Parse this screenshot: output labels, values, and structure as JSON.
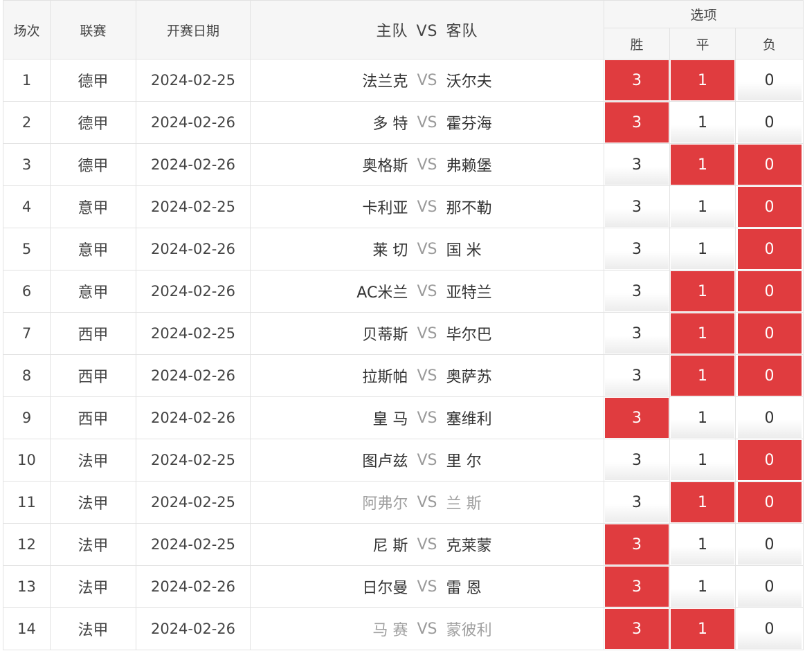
{
  "header": {
    "col_no": "场次",
    "col_league": "联赛",
    "col_date": "开赛日期",
    "col_home": "主队",
    "col_vs": "VS",
    "col_away": "客队",
    "col_options": "选项",
    "opt_win": "胜",
    "opt_draw": "平",
    "opt_loss": "负"
  },
  "colors": {
    "selected": "#e03c3f",
    "muted_team": "#a0a0a0"
  },
  "rows": [
    {
      "no": "1",
      "league": "德甲",
      "date": "2024-02-25",
      "home": "法兰克",
      "vs": "VS",
      "away": "沃尔夫",
      "muted_home": false,
      "muted_away": false,
      "win": "3",
      "draw": "1",
      "loss": "0",
      "sel": [
        true,
        true,
        false
      ]
    },
    {
      "no": "2",
      "league": "德甲",
      "date": "2024-02-26",
      "home": "多 特",
      "vs": "VS",
      "away": "霍芬海",
      "muted_home": false,
      "muted_away": false,
      "win": "3",
      "draw": "1",
      "loss": "0",
      "sel": [
        true,
        false,
        false
      ]
    },
    {
      "no": "3",
      "league": "德甲",
      "date": "2024-02-26",
      "home": "奥格斯",
      "vs": "VS",
      "away": "弗赖堡",
      "muted_home": false,
      "muted_away": false,
      "win": "3",
      "draw": "1",
      "loss": "0",
      "sel": [
        false,
        true,
        true
      ]
    },
    {
      "no": "4",
      "league": "意甲",
      "date": "2024-02-25",
      "home": "卡利亚",
      "vs": "VS",
      "away": "那不勒",
      "muted_home": false,
      "muted_away": false,
      "win": "3",
      "draw": "1",
      "loss": "0",
      "sel": [
        false,
        false,
        true
      ]
    },
    {
      "no": "5",
      "league": "意甲",
      "date": "2024-02-26",
      "home": "莱 切",
      "vs": "VS",
      "away": "国 米",
      "muted_home": false,
      "muted_away": false,
      "win": "3",
      "draw": "1",
      "loss": "0",
      "sel": [
        false,
        false,
        true
      ]
    },
    {
      "no": "6",
      "league": "意甲",
      "date": "2024-02-26",
      "home": "AC米兰",
      "vs": "VS",
      "away": "亚特兰",
      "muted_home": false,
      "muted_away": false,
      "win": "3",
      "draw": "1",
      "loss": "0",
      "sel": [
        false,
        true,
        true
      ]
    },
    {
      "no": "7",
      "league": "西甲",
      "date": "2024-02-25",
      "home": "贝蒂斯",
      "vs": "VS",
      "away": "毕尔巴",
      "muted_home": false,
      "muted_away": false,
      "win": "3",
      "draw": "1",
      "loss": "0",
      "sel": [
        false,
        true,
        true
      ]
    },
    {
      "no": "8",
      "league": "西甲",
      "date": "2024-02-26",
      "home": "拉斯帕",
      "vs": "VS",
      "away": "奥萨苏",
      "muted_home": false,
      "muted_away": false,
      "win": "3",
      "draw": "1",
      "loss": "0",
      "sel": [
        false,
        true,
        true
      ]
    },
    {
      "no": "9",
      "league": "西甲",
      "date": "2024-02-26",
      "home": "皇 马",
      "vs": "VS",
      "away": "塞维利",
      "muted_home": false,
      "muted_away": false,
      "win": "3",
      "draw": "1",
      "loss": "0",
      "sel": [
        true,
        false,
        false
      ]
    },
    {
      "no": "10",
      "league": "法甲",
      "date": "2024-02-25",
      "home": "图卢兹",
      "vs": "VS",
      "away": "里 尔",
      "muted_home": false,
      "muted_away": false,
      "win": "3",
      "draw": "1",
      "loss": "0",
      "sel": [
        false,
        false,
        true
      ]
    },
    {
      "no": "11",
      "league": "法甲",
      "date": "2024-02-25",
      "home": "阿弗尔",
      "vs": "VS",
      "away": "兰 斯",
      "muted_home": true,
      "muted_away": true,
      "win": "3",
      "draw": "1",
      "loss": "0",
      "sel": [
        false,
        true,
        true
      ]
    },
    {
      "no": "12",
      "league": "法甲",
      "date": "2024-02-25",
      "home": "尼 斯",
      "vs": "VS",
      "away": "克莱蒙",
      "muted_home": false,
      "muted_away": false,
      "win": "3",
      "draw": "1",
      "loss": "0",
      "sel": [
        true,
        false,
        false
      ]
    },
    {
      "no": "13",
      "league": "法甲",
      "date": "2024-02-26",
      "home": "日尔曼",
      "vs": "VS",
      "away": "雷 恩",
      "muted_home": false,
      "muted_away": false,
      "win": "3",
      "draw": "1",
      "loss": "0",
      "sel": [
        true,
        false,
        false
      ]
    },
    {
      "no": "14",
      "league": "法甲",
      "date": "2024-02-26",
      "home": "马 赛",
      "vs": "VS",
      "away": "蒙彼利",
      "muted_home": true,
      "muted_away": true,
      "win": "3",
      "draw": "1",
      "loss": "0",
      "sel": [
        true,
        true,
        false
      ]
    }
  ]
}
